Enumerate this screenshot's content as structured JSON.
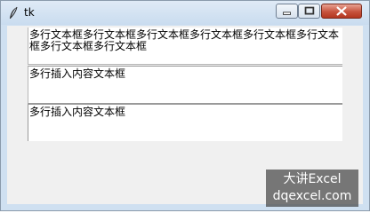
{
  "window": {
    "title": "tk",
    "icon": "feather-icon"
  },
  "controls": {
    "minimize_icon": "minimize-icon",
    "maximize_icon": "maximize-icon",
    "close_icon": "close-icon"
  },
  "textboxes": [
    {
      "value": "多行文本框多行文本框多行文本框多行文本框多行文本框多行文本框多行文本框多行文本框"
    },
    {
      "value": "多行插入内容文本框"
    },
    {
      "value": "多行插入内容文本框"
    }
  ],
  "watermark": {
    "line1": "大讲Excel",
    "line2": "dqexcel.com"
  }
}
